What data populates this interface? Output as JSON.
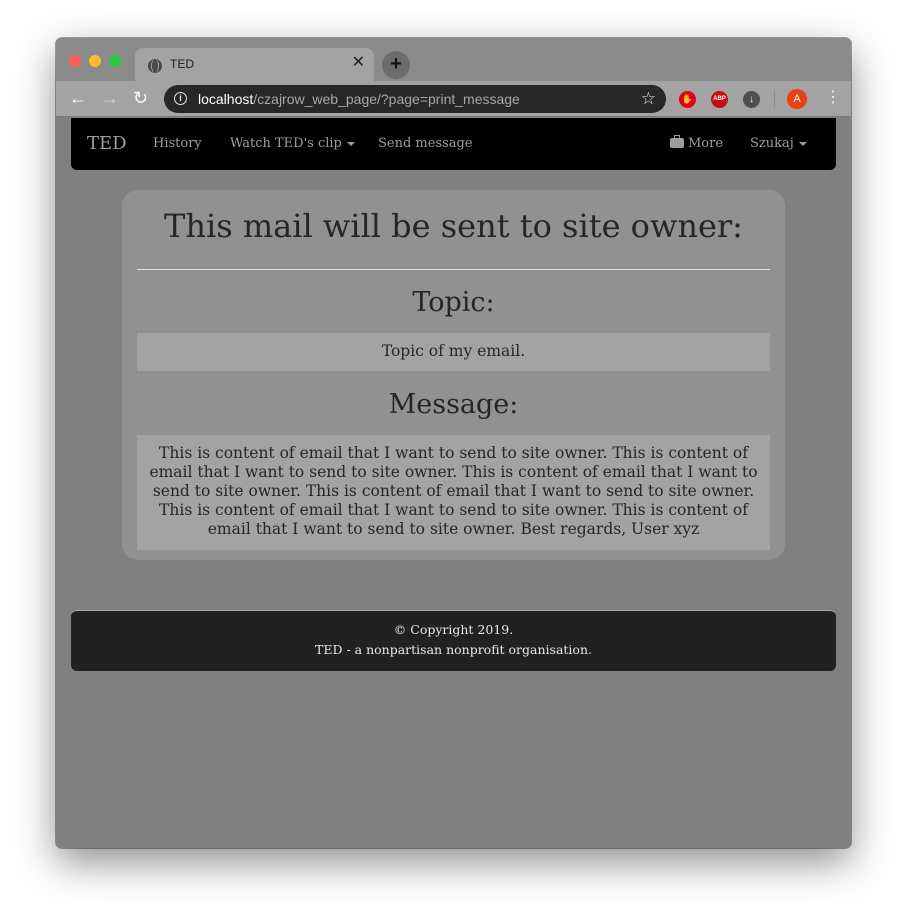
{
  "browser": {
    "tab_title": "TED",
    "tab_close": "✕",
    "new_tab": "+",
    "url_host": "localhost",
    "url_path": "/czajrow_web_page/?page=print_message",
    "profile_initial": "A",
    "extension_abp": "ABP",
    "icons": {
      "back": "arrow-left",
      "forward": "arrow-right",
      "reload": "reload",
      "info": "info",
      "bookmark": "star",
      "menu": "kebab"
    }
  },
  "nav": {
    "brand": "TED",
    "items": [
      "History",
      "Watch TED's clip",
      "Send message"
    ],
    "right": [
      "More",
      "Szukaj"
    ]
  },
  "content": {
    "heading": "This mail will be sent to site owner:",
    "topic_label": "Topic:",
    "topic_value": "Topic of my email.",
    "message_label": "Message:",
    "message_value": "This is content of email that I want to send to site owner. This is content of email that I want to send to site owner. This is content of email that I want to send to site owner. This is content of email that I want to send to site owner. This is content of email that I want to send to site owner. This is content of email that I want to send to site owner. Best regards, User xyz"
  },
  "footer": {
    "copyright": "© Copyright 2019.",
    "tagline": "TED - a nonpartisan nonprofit organisation."
  },
  "colors": {
    "navbar": "#000000",
    "card": "#919191",
    "field": "#a3a3a3",
    "footer": "#212121",
    "page": "#808080"
  }
}
